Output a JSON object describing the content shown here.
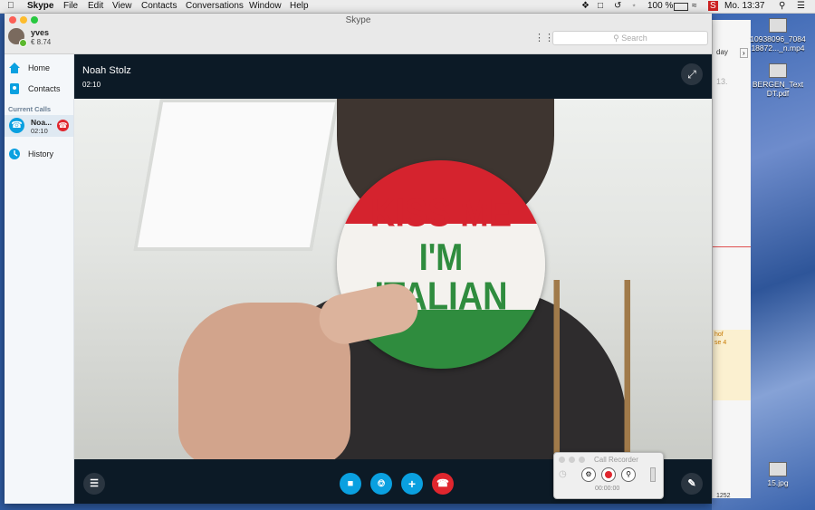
{
  "menubar": {
    "app": "Skype",
    "items": [
      "File",
      "Edit",
      "View",
      "Contacts",
      "Conversations",
      "Window",
      "Help"
    ],
    "battery": "100 %",
    "clock": "Mo. 13:37"
  },
  "desktop": {
    "icons": [
      {
        "label": "10938096_7084 18872..._n.mp4"
      },
      {
        "label": "BERGEN_Text DT.pdf"
      },
      {
        "label": "15.jpg"
      }
    ]
  },
  "window": {
    "title": "Skype",
    "search_placeholder": "Search",
    "user": {
      "name": "yves",
      "credit": "€ 8.74"
    }
  },
  "sidebar": {
    "home": "Home",
    "contacts": "Contacts",
    "section": "Current Calls",
    "call": {
      "name": "Noa...",
      "time": "02:10"
    },
    "history": "History"
  },
  "call": {
    "name": "Noah Stolz",
    "duration": "02:10"
  },
  "badge": {
    "line1": "KISS ME",
    "line2": "I'M",
    "line3": "ITALIAN"
  },
  "recorder": {
    "title": "Call Recorder",
    "time": "00:00:00"
  },
  "background_window": {
    "day": "day",
    "date": "13.",
    "event1": "hof",
    "event2": "se 4",
    "number": "1252"
  },
  "colors": {
    "accent": "#0aa0e0",
    "hangup": "#e0262e",
    "badge_red": "#d5232e",
    "badge_green": "#2f8c3e"
  }
}
